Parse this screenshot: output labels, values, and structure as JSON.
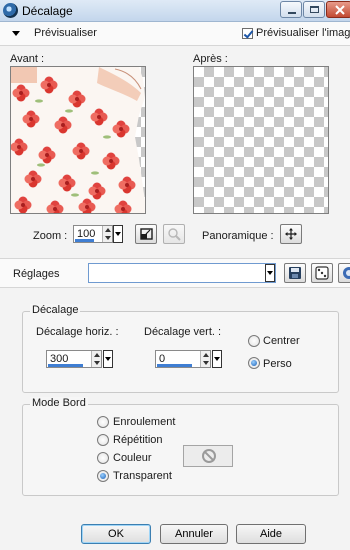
{
  "window": {
    "title": "Décalage"
  },
  "preview": {
    "header_label": "Prévisualiser",
    "checkbox_label": "Prévisualiser l'image",
    "checkbox_checked": true,
    "before_label": "Avant :",
    "after_label": "Après :"
  },
  "zoom": {
    "label": "Zoom :",
    "value": "100"
  },
  "pan": {
    "label": "Panoramique :"
  },
  "presets": {
    "label": "Réglages",
    "value": ""
  },
  "offset": {
    "group_title": "Décalage",
    "horiz_label": "Décalage horiz. :",
    "horiz_value": "300",
    "vert_label": "Décalage vert. :",
    "vert_value": "0",
    "mode_options": [
      {
        "label": "Centrer",
        "selected": false
      },
      {
        "label": "Perso",
        "selected": true
      }
    ]
  },
  "edge_mode": {
    "group_title": "Mode Bord",
    "options": [
      {
        "label": "Enroulement",
        "selected": false
      },
      {
        "label": "Répétition",
        "selected": false
      },
      {
        "label": "Couleur",
        "selected": false
      },
      {
        "label": "Transparent",
        "selected": true
      }
    ]
  },
  "buttons": {
    "ok": "OK",
    "cancel": "Annuler",
    "help": "Aide"
  },
  "icons": {
    "app": "app-icon",
    "fit": "fit-to-window-icon",
    "zoom_tool": "magnifier-icon",
    "pan": "pan-move-icon",
    "save_preset": "save-preset-icon",
    "randomize": "randomize-dice-icon",
    "reset": "reset-icon",
    "no_color": "no-color-icon"
  },
  "colors": {
    "accent": "#3f7ed3",
    "checker": "#c8c8c8",
    "flower": "#e0433f"
  }
}
